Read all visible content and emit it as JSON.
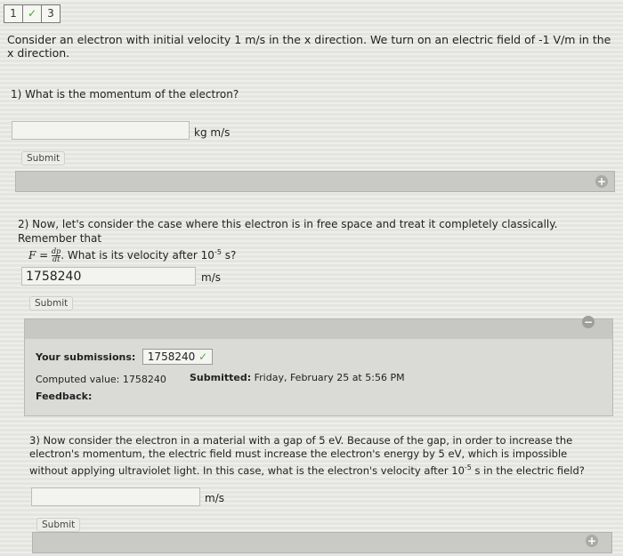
{
  "steps": [
    {
      "label": "1"
    },
    {
      "label": "✓"
    },
    {
      "label": "3"
    }
  ],
  "problem": {
    "text": "Consider an electron with initial velocity 1 m/s in the x direction. We turn on an electric field of -1 V/m in the x direction."
  },
  "q1": {
    "text": "1) What is the momentum of the electron?",
    "value": "",
    "unit": "kg m/s",
    "submit": "Submit"
  },
  "q2": {
    "text_a": "2) Now, let's consider the case where this electron is in free space and treat it completely classically. Remember that",
    "formula_lhs": "F =",
    "formula_num": "dp",
    "formula_den": "dt",
    "text_b": ". What is its velocity after 10",
    "exp": "-5",
    "text_c": " s?",
    "value": "1758240",
    "unit": "m/s",
    "submit": "Submit"
  },
  "feedback": {
    "submissions_label": "Your submissions:",
    "submitted_value": "1758240",
    "computed_label": "Computed value: 1758240",
    "submitted_label": "Submitted:",
    "submitted_time": "Friday, February 25 at 5:56 PM",
    "feedback_label": "Feedback:"
  },
  "q3": {
    "text_a": "3) Now consider the electron in a material with a gap of 5 eV. Because of the gap, in order to increase the electron's momentum, the electric field must increase the electron's energy by 5 eV, which is impossible without applying ultraviolet light. In this case, what is the electron's velocity after 10",
    "exp": "-5",
    "text_b": " s in the electric field?",
    "value": "",
    "unit": "m/s",
    "submit": "Submit"
  },
  "icons": {
    "plus": "+",
    "minus": "−",
    "check": "✓"
  }
}
